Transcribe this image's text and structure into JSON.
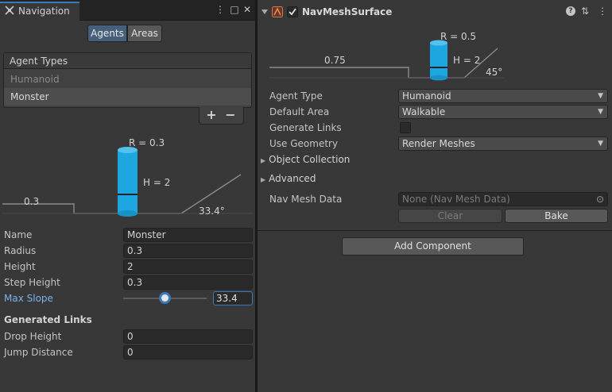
{
  "navigation": {
    "tab_title": "Navigation",
    "menu_glyph": "⋮",
    "maximize_glyph": "□",
    "close_glyph": "✕",
    "agents_tab": "Agents",
    "areas_tab": "Areas",
    "agent_types_header": "Agent Types",
    "agent_types": [
      "Humanoid",
      "Monster"
    ],
    "add_glyph": "+",
    "remove_glyph": "−",
    "diagram": {
      "radius_label": "R = 0.3",
      "height_label": "H = 2",
      "step_label": "0.3",
      "slope_label": "33.4°"
    },
    "fields": {
      "name": {
        "label": "Name",
        "value": "Monster"
      },
      "radius": {
        "label": "Radius",
        "value": "0.3"
      },
      "height": {
        "label": "Height",
        "value": "2"
      },
      "step_height": {
        "label": "Step Height",
        "value": "0.3"
      },
      "max_slope": {
        "label": "Max Slope",
        "value": "33.4",
        "slider_fraction": 0.5
      }
    },
    "generated_links": {
      "heading": "Generated Links",
      "drop_height": {
        "label": "Drop Height",
        "value": "0"
      },
      "jump_distance": {
        "label": "Jump Distance",
        "value": "0"
      }
    }
  },
  "navmesh_surface": {
    "title": "NavMeshSurface",
    "icon_names": [
      "fold-arrow-icon",
      "navmesh-surface-icon",
      "enabled-checkbox-icon",
      "help-icon",
      "presets-icon",
      "more-menu-icon"
    ],
    "help_glyph": "?",
    "presets_glyph": "⇅",
    "more_glyph": "⋮",
    "diagram": {
      "radius_label": "R = 0.5",
      "height_label": "H = 2",
      "step_label": "0.75",
      "slope_label": "45°"
    },
    "agent_type": {
      "label": "Agent Type",
      "value": "Humanoid"
    },
    "default_area": {
      "label": "Default Area",
      "value": "Walkable"
    },
    "generate_links": {
      "label": "Generate Links",
      "checked": false
    },
    "use_geometry": {
      "label": "Use Geometry",
      "value": "Render Meshes"
    },
    "object_collection": "Object Collection",
    "advanced": "Advanced",
    "nav_mesh_data": {
      "label": "Nav Mesh Data",
      "value": "None (Nav Mesh Data)"
    },
    "clear_button": "Clear",
    "bake_button": "Bake",
    "add_component_button": "Add Component",
    "dropdown_arrow": "▼",
    "foldout_arrow": "▶",
    "object_picker_glyph": "⊙"
  },
  "colors": {
    "accent": "#3a79bb",
    "agent_cylinder": "#1ea6e0",
    "label_blue": "#7ab3ec"
  }
}
